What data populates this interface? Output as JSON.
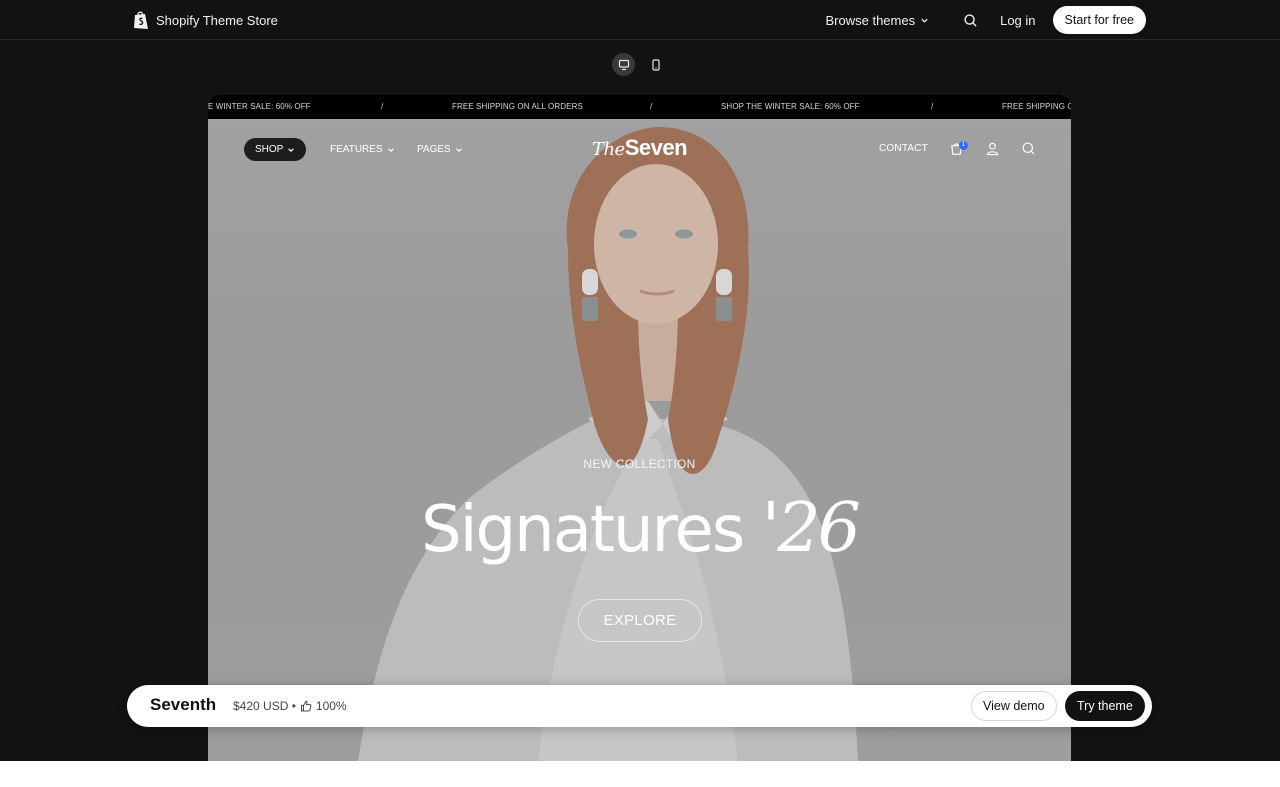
{
  "topnav": {
    "brand": "Shopify Theme Store",
    "browse": "Browse themes",
    "login": "Log in",
    "start": "Start for free"
  },
  "device_toggles": [
    "desktop-icon",
    "mobile-icon"
  ],
  "preview": {
    "ticker": [
      "E WINTER SALE: 60% OFF",
      "/",
      "FREE SHIPPING ON ALL ORDERS",
      "/",
      "SHOP THE WINTER SALE: 60% OFF",
      "/",
      "FREE SHIPPING O"
    ],
    "nav": {
      "shop": "SHOP",
      "features": "FEATURES",
      "pages": "PAGES",
      "logo_the": "The",
      "logo_seven": "Seven",
      "contact": "CONTACT",
      "cart_count": "1"
    },
    "hero": {
      "subtitle": "NEW COLLECTION",
      "title": "Signatures",
      "year": "'26",
      "cta": "EXPLORE"
    }
  },
  "infobar": {
    "name": "Seventh",
    "price": "$420 USD •",
    "rating": "100%",
    "view_demo": "View demo",
    "try_theme": "Try theme"
  },
  "colors": {
    "page_bg": "#131112",
    "accent_badge": "#2f6bff",
    "hero_bg": "#a3a3a3"
  }
}
